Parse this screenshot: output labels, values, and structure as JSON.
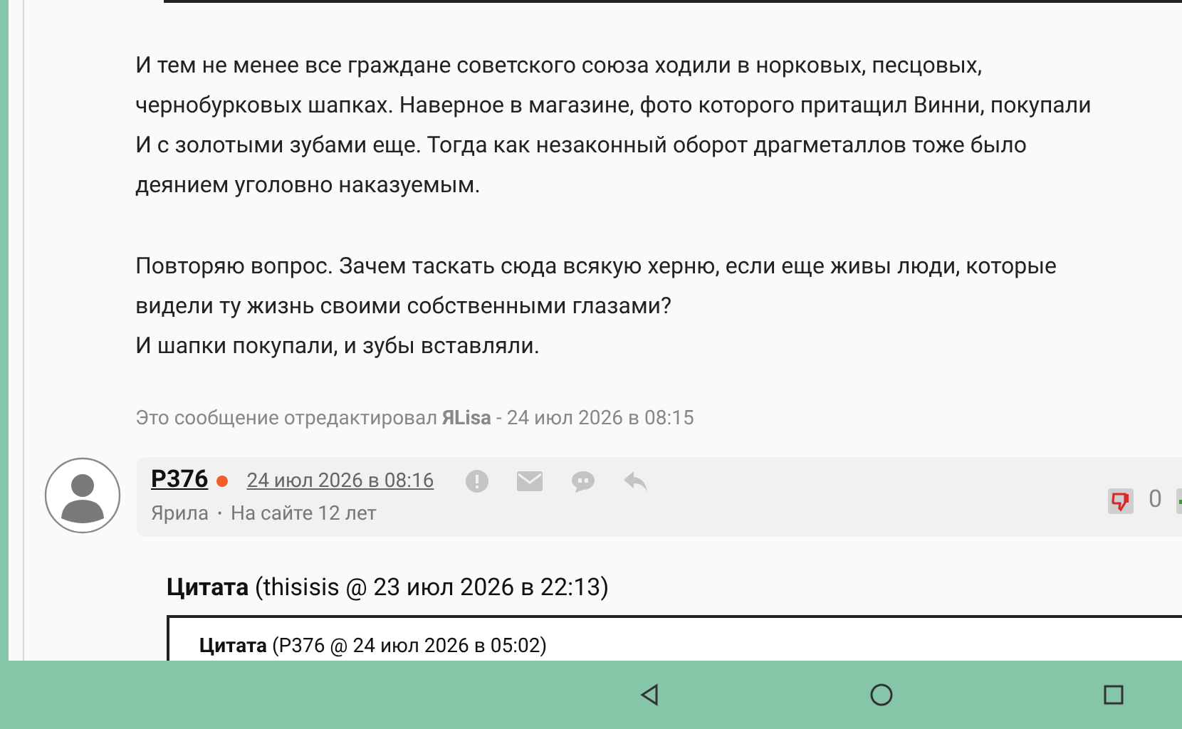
{
  "post_body": {
    "paragraphs": [
      [
        "И тем не менее все граждане советского союза ходили в норковых, песцовых,",
        "чернобурковых шапках. Наверное в магазине, фото которого притащил Винни, покупали",
        "И с золотыми зубами еще. Тогда как незаконный оборот драгметаллов тоже было",
        "деянием уголовно наказуемым."
      ],
      [
        "Повторяю вопрос. Зачем таскать сюда всякую херню, если еще живы люди, которые",
        "видели ту жизнь своими собственными глазами?",
        "И шапки покупали, и зубы вставляли."
      ]
    ],
    "edit_note": "Это сообщение отредактировал **ЯLisa** - 24 июл 2026 в 08:15"
  },
  "reply": {
    "username": "P376",
    "online": true,
    "date": "24 июл 2026 в 08:16",
    "rank": "Ярила",
    "separator": "•",
    "membership": "На сайте 12 лет",
    "rating": "0",
    "quote": {
      "label": "Цитата",
      "source": "(thisisis @ 23 июл 2026 в 22:13)",
      "nested": {
        "label": "Цитата",
        "source": "(P376 @ 24 июл 2026 в 05:02)"
      }
    }
  }
}
